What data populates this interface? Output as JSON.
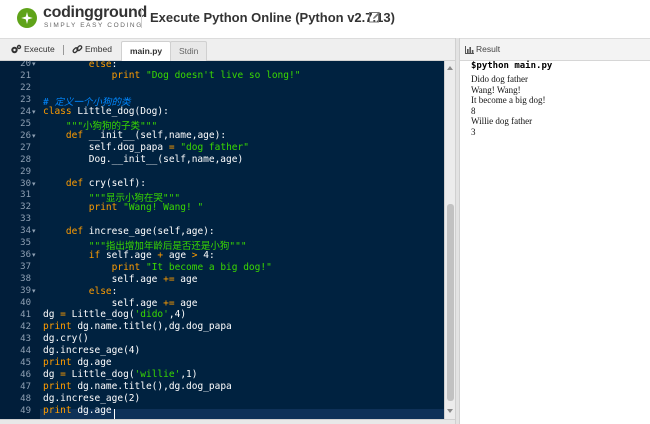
{
  "header": {
    "logo_name": "codingground",
    "logo_tagline": "SIMPLY EASY CODING",
    "page_title": "Execute Python Online (Python v2.7.13)"
  },
  "toolbar": {
    "execute_label": "Execute",
    "embed_label": "Embed",
    "tabs": [
      {
        "label": "main.py",
        "active": true
      },
      {
        "label": "Stdin",
        "active": false
      }
    ]
  },
  "editor": {
    "current_line": 49,
    "lines": [
      {
        "n": "20",
        "fold": true,
        "tokens": [
          {
            "t": "        "
          },
          {
            "t": "else",
            "k": "kw"
          },
          {
            "t": ":"
          }
        ]
      },
      {
        "n": "21",
        "fold": false,
        "tokens": [
          {
            "t": "            "
          },
          {
            "t": "print",
            "k": "kw"
          },
          {
            "t": " "
          },
          {
            "t": "\"Dog doesn't live so long!\"",
            "k": "st"
          }
        ]
      },
      {
        "n": "22",
        "fold": false,
        "tokens": []
      },
      {
        "n": "23",
        "fold": false,
        "tokens": [
          {
            "t": "# 定义一个小狗的类",
            "k": "cm"
          }
        ]
      },
      {
        "n": "24",
        "fold": true,
        "tokens": [
          {
            "t": "class",
            "k": "kw"
          },
          {
            "t": " Little_dog(Dog):"
          }
        ]
      },
      {
        "n": "25",
        "fold": false,
        "tokens": [
          {
            "t": "    "
          },
          {
            "t": "\"\"\"小狗狗的子类\"\"\"",
            "k": "st"
          }
        ]
      },
      {
        "n": "26",
        "fold": true,
        "tokens": [
          {
            "t": "    "
          },
          {
            "t": "def",
            "k": "kw"
          },
          {
            "t": " __init__(self,name,age):"
          }
        ]
      },
      {
        "n": "27",
        "fold": false,
        "tokens": [
          {
            "t": "        self.dog_papa "
          },
          {
            "t": "=",
            "k": "op"
          },
          {
            "t": " "
          },
          {
            "t": "\"dog father\"",
            "k": "st"
          }
        ]
      },
      {
        "n": "28",
        "fold": false,
        "tokens": [
          {
            "t": "        Dog.__init__(self,name,age)"
          }
        ]
      },
      {
        "n": "29",
        "fold": false,
        "tokens": []
      },
      {
        "n": "30",
        "fold": true,
        "tokens": [
          {
            "t": "    "
          },
          {
            "t": "def",
            "k": "kw"
          },
          {
            "t": " cry(self):"
          }
        ]
      },
      {
        "n": "31",
        "fold": false,
        "tokens": [
          {
            "t": "        "
          },
          {
            "t": "\"\"\"显示小狗在哭\"\"\"",
            "k": "st"
          }
        ]
      },
      {
        "n": "32",
        "fold": false,
        "tokens": [
          {
            "t": "        "
          },
          {
            "t": "print",
            "k": "kw"
          },
          {
            "t": " "
          },
          {
            "t": "\"Wang! Wang! \"",
            "k": "st"
          }
        ]
      },
      {
        "n": "33",
        "fold": false,
        "tokens": []
      },
      {
        "n": "34",
        "fold": true,
        "tokens": [
          {
            "t": "    "
          },
          {
            "t": "def",
            "k": "kw"
          },
          {
            "t": " increse_age(self,age):"
          }
        ]
      },
      {
        "n": "35",
        "fold": false,
        "tokens": [
          {
            "t": "        "
          },
          {
            "t": "\"\"\"指出增加年龄后是否还是小狗\"\"\"",
            "k": "st"
          }
        ]
      },
      {
        "n": "36",
        "fold": true,
        "tokens": [
          {
            "t": "        "
          },
          {
            "t": "if",
            "k": "kw"
          },
          {
            "t": " self.age "
          },
          {
            "t": "+",
            "k": "op"
          },
          {
            "t": " age "
          },
          {
            "t": ">",
            "k": "op"
          },
          {
            "t": " 4:"
          }
        ]
      },
      {
        "n": "37",
        "fold": false,
        "tokens": [
          {
            "t": "            "
          },
          {
            "t": "print",
            "k": "kw"
          },
          {
            "t": " "
          },
          {
            "t": "\"It become a big dog!\"",
            "k": "st"
          }
        ]
      },
      {
        "n": "38",
        "fold": false,
        "tokens": [
          {
            "t": "            self.age "
          },
          {
            "t": "+=",
            "k": "op"
          },
          {
            "t": " age"
          }
        ]
      },
      {
        "n": "39",
        "fold": true,
        "tokens": [
          {
            "t": "        "
          },
          {
            "t": "else",
            "k": "kw"
          },
          {
            "t": ":"
          }
        ]
      },
      {
        "n": "40",
        "fold": false,
        "tokens": [
          {
            "t": "            self.age "
          },
          {
            "t": "+=",
            "k": "op"
          },
          {
            "t": " age"
          }
        ]
      },
      {
        "n": "41",
        "fold": false,
        "tokens": [
          {
            "t": "dg "
          },
          {
            "t": "=",
            "k": "op"
          },
          {
            "t": " Little_dog("
          },
          {
            "t": "'dido'",
            "k": "st"
          },
          {
            "t": ",4)"
          }
        ]
      },
      {
        "n": "42",
        "fold": false,
        "tokens": [
          {
            "t": "print",
            "k": "kw"
          },
          {
            "t": " dg.name.title(),dg.dog_papa"
          }
        ]
      },
      {
        "n": "43",
        "fold": false,
        "tokens": [
          {
            "t": "dg.cry()"
          }
        ]
      },
      {
        "n": "44",
        "fold": false,
        "tokens": [
          {
            "t": "dg.increse_age(4)"
          }
        ]
      },
      {
        "n": "45",
        "fold": false,
        "tokens": [
          {
            "t": "print",
            "k": "kw"
          },
          {
            "t": " dg.age"
          }
        ]
      },
      {
        "n": "46",
        "fold": false,
        "tokens": [
          {
            "t": "dg "
          },
          {
            "t": "=",
            "k": "op"
          },
          {
            "t": " Little_dog("
          },
          {
            "t": "'willie'",
            "k": "st"
          },
          {
            "t": ",1)"
          }
        ]
      },
      {
        "n": "47",
        "fold": false,
        "tokens": [
          {
            "t": "print",
            "k": "kw"
          },
          {
            "t": " dg.name.title(),dg.dog_papa"
          }
        ]
      },
      {
        "n": "48",
        "fold": false,
        "tokens": [
          {
            "t": "dg.increse_age(2)"
          }
        ]
      },
      {
        "n": "49",
        "fold": false,
        "tokens": [
          {
            "t": "print",
            "k": "kw"
          },
          {
            "t": " dg.age"
          }
        ]
      }
    ]
  },
  "result": {
    "title": "Result",
    "prompt": "$python main.py",
    "output": [
      "Dido dog father",
      "Wang! Wang!",
      "It become a big dog!",
      "8",
      "Willie dog father",
      "3"
    ]
  },
  "colors": {
    "editor_bg": "#002240",
    "keyword": "#ff9d00",
    "string": "#3ad900",
    "comment": "#0088ff",
    "logo_green": "#5fa319"
  }
}
